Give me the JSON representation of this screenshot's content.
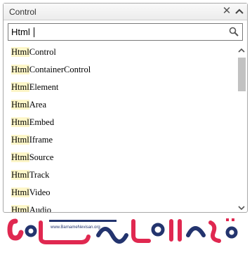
{
  "combo": {
    "selected_text": "Control",
    "clear_icon": "close-icon",
    "toggle_icon": "chevron-up-icon"
  },
  "search": {
    "value": "Html",
    "icon": "search-icon"
  },
  "list": {
    "highlight_prefix": "Html",
    "items": [
      {
        "match": "Html",
        "rest": "Control"
      },
      {
        "match": "Html",
        "rest": "ContainerControl"
      },
      {
        "match": "Html",
        "rest": "Element"
      },
      {
        "match": "Html",
        "rest": "Area"
      },
      {
        "match": "Html",
        "rest": "Embed"
      },
      {
        "match": "Html",
        "rest": "Iframe"
      },
      {
        "match": "Html",
        "rest": "Source"
      },
      {
        "match": "Html",
        "rest": "Track"
      },
      {
        "match": "Html",
        "rest": "Video"
      },
      {
        "match": "Html",
        "rest": "Audio"
      }
    ]
  },
  "colors": {
    "highlight": "#fdf6c8",
    "logo_red": "#e02850",
    "logo_navy": "#23346e"
  },
  "logo": {
    "url_text": "www.BarnameNevisan.org"
  }
}
